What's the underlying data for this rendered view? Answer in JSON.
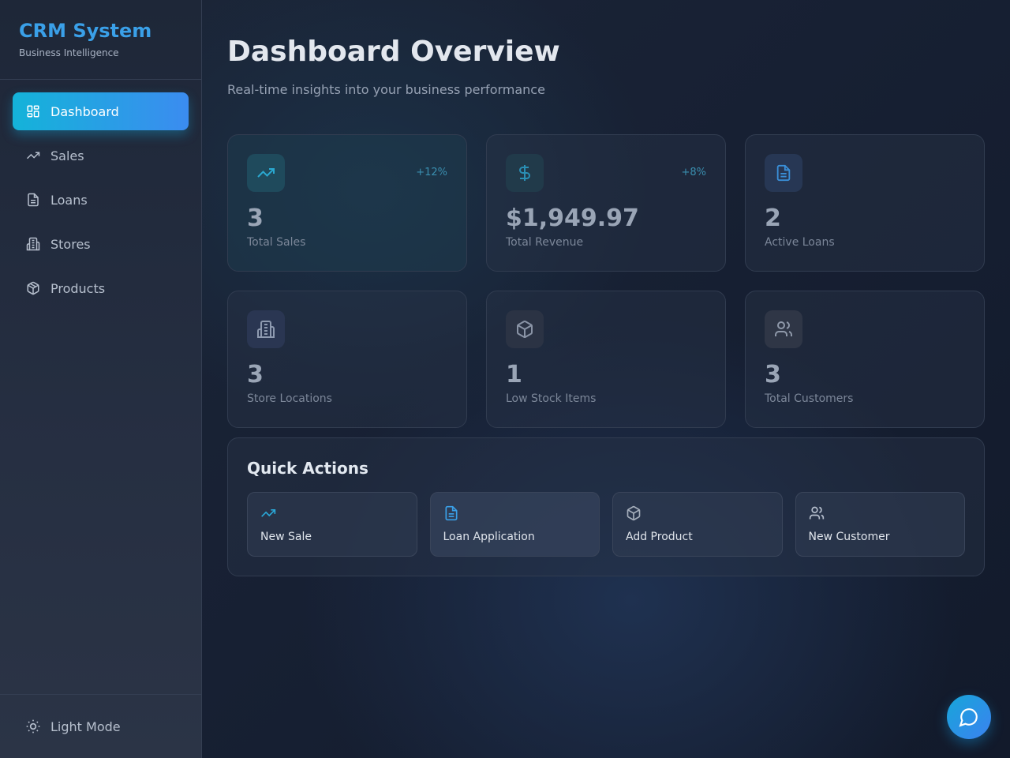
{
  "brand": {
    "title": "CRM System",
    "subtitle": "Business Intelligence"
  },
  "sidebar": {
    "items": [
      {
        "label": "Dashboard",
        "icon": "dashboard-icon",
        "active": true
      },
      {
        "label": "Sales",
        "icon": "trending-up-icon"
      },
      {
        "label": "Loans",
        "icon": "document-icon"
      },
      {
        "label": "Stores",
        "icon": "building-icon"
      },
      {
        "label": "Products",
        "icon": "box-icon"
      }
    ],
    "theme_toggle": {
      "label": "Light Mode",
      "icon": "sun-icon"
    }
  },
  "header": {
    "title": "Dashboard Overview",
    "subtitle": "Real-time insights into your business performance"
  },
  "stats": [
    {
      "value": "3",
      "label": "Total Sales",
      "trend": "+12%",
      "icon": "trending-up-icon"
    },
    {
      "value": "$1,949.97",
      "label": "Total Revenue",
      "trend": "+8%",
      "icon": "dollar-icon"
    },
    {
      "value": "2",
      "label": "Active Loans",
      "icon": "document-icon"
    },
    {
      "value": "3",
      "label": "Store Locations",
      "icon": "building-icon"
    },
    {
      "value": "1",
      "label": "Low Stock Items",
      "icon": "box-icon"
    },
    {
      "value": "3",
      "label": "Total Customers",
      "icon": "users-icon"
    }
  ],
  "quick_actions": {
    "title": "Quick Actions",
    "items": [
      {
        "label": "New Sale",
        "icon": "trending-up-icon"
      },
      {
        "label": "Loan Application",
        "icon": "document-icon"
      },
      {
        "label": "Add Product",
        "icon": "box-icon"
      },
      {
        "label": "New Customer",
        "icon": "users-icon"
      }
    ]
  },
  "chat": {
    "icon": "chat-icon"
  },
  "colors": {
    "accent": "#3aa0e8",
    "active_gradient_start": "#14b3d9",
    "active_gradient_end": "#3b8cf0"
  }
}
